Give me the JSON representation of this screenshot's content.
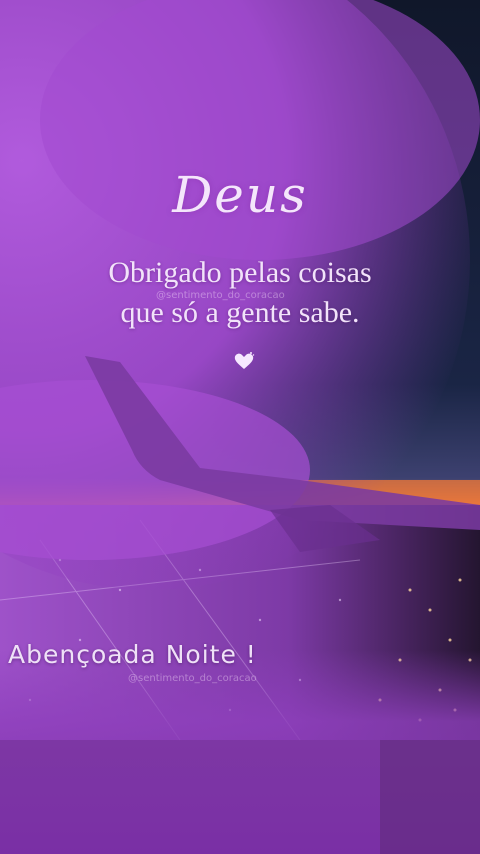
{
  "post": {
    "title": "Deus",
    "message_line_1": "Obrigado pelas coisas",
    "message_line_2": "que só a gente sabe.",
    "blessing": "Abençoada Noite !",
    "watermark": "@sentimento_do_coracao"
  },
  "icons": {
    "heart": "heart-icon"
  },
  "colors": {
    "purple_overlay": "#a24ad0",
    "night_sky": "#0f1430",
    "sunset_orange": "#e8763a",
    "text": "#f2e3fa"
  }
}
